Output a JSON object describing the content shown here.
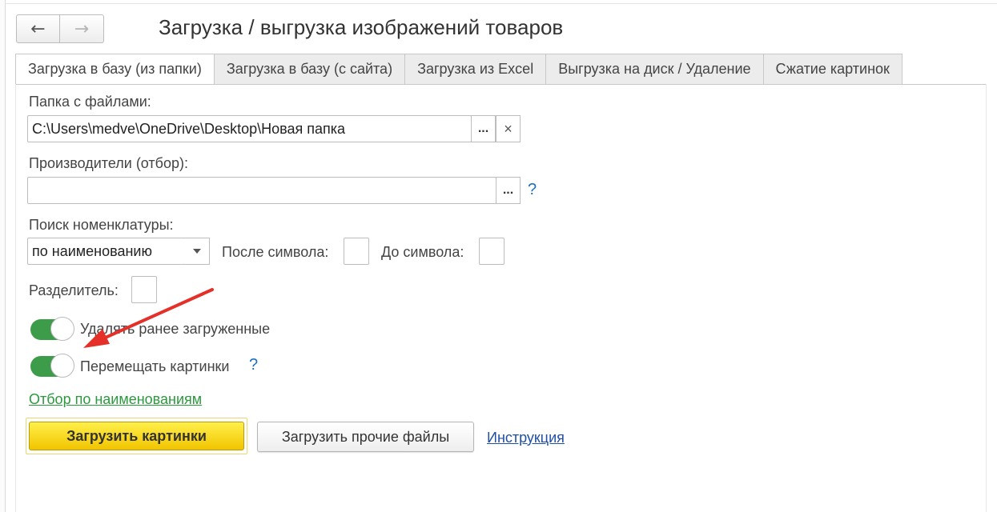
{
  "window": {
    "title": "Загрузка / выгрузка изображений товаров",
    "nav": {
      "back_icon": "←",
      "forward_icon": "→"
    }
  },
  "tabs": [
    {
      "label": "Загрузка в базу (из папки)",
      "active": true
    },
    {
      "label": "Загрузка в базу (с сайта)",
      "active": false
    },
    {
      "label": "Загрузка из Excel",
      "active": false
    },
    {
      "label": "Выгрузка на диск / Удаление",
      "active": false
    },
    {
      "label": "Сжатие картинок",
      "active": false
    }
  ],
  "folder": {
    "label": "Папка с файлами:",
    "value": "C:\\Users\\medve\\OneDrive\\Desktop\\Новая папка",
    "select_button": "...",
    "clear_button": "×"
  },
  "manufacturers": {
    "label": "Производители (отбор):",
    "value": "",
    "select_button": "...",
    "help": "?"
  },
  "search": {
    "label": "Поиск номенклатуры:",
    "value": "по наименованию",
    "after_symbol_label": "После символа:",
    "before_symbol_label": "До символа:"
  },
  "separator": {
    "label": "Разделитель:"
  },
  "toggles": [
    {
      "label": "Удалять ранее загруженные",
      "on": true
    },
    {
      "label": "Перемещать картинки",
      "on": true,
      "help": "?"
    }
  ],
  "filter_link": "Отбор по наименованиям",
  "actions": {
    "primary": "Загрузить картинки",
    "secondary": "Загрузить прочие файлы",
    "instruction_link": "Инструкция"
  },
  "colors": {
    "accent_yellow": "#f5d800",
    "toggle_green": "#3d9c4a",
    "link_green": "#2a9a3c",
    "link_blue": "#1e4fa8",
    "annotation_arrow": "#e5302a"
  }
}
